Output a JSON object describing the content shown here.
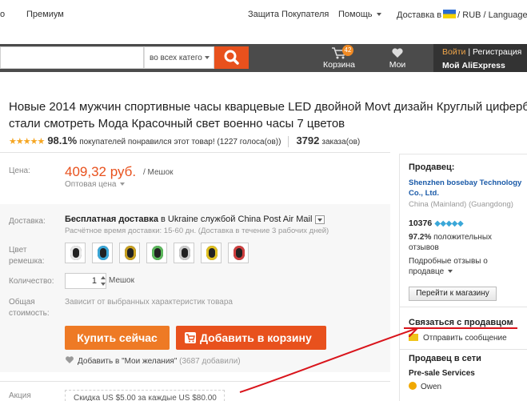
{
  "topbar": {
    "left_partial": "о",
    "premium": "Премиум",
    "buyer_protection": "Защита Покупателя",
    "help": "Помощь",
    "ship_to": "Доставка в",
    "currency_lang": "/ RUB / Language"
  },
  "search": {
    "category": "во всех катего",
    "icon": "search-icon"
  },
  "nav": {
    "cart_label": "Корзина",
    "cart_count": "42",
    "wishlist_label": "Мои желания",
    "login": "Войти",
    "register": "| Регистрация",
    "my_account": "Мой AliExpress"
  },
  "product": {
    "title_line1": "Новые 2014 мужчин спортивные часы кварцевые LED двойной Movt дизайн Круглый циферблат",
    "title_line2": "стали смотреть Мода Красочный свет военно часы 7 цветов",
    "stars": "★★★★★",
    "rating_pct": "98.1%",
    "rating_text": "покупателей понравился этот товар! (1227 голоса(ов))",
    "orders_count": "3792",
    "orders_label": "заказа(ов)",
    "price_label": "Цена:",
    "price": "409,32 руб.",
    "per_unit": "/ Мешок",
    "wholesale": "Оптовая цена",
    "shipping_label": "Доставка:",
    "shipping_free": "Бесплатная доставка",
    "shipping_rest": "в  Ukraine службой China Post Air Mail",
    "shipping_time": "Расчётное время доставки: 15-60 дн. (Доставка в течение 3 рабочих дней)",
    "color_label_1": "Цвет",
    "color_label_2": "ремешка:",
    "quantity_label": "Количество:",
    "quantity_value": "1",
    "quantity_unit": "Мешок",
    "total_label_1": "Общая",
    "total_label_2": "стоимость:",
    "total_note": "Зависит от выбранных характеристик товара",
    "buy_now": "Купить сейчас",
    "add_to_cart": "Добавить в корзину",
    "wish_text": "Добавить в \"Мои желания\"",
    "wish_count": "(3687 добавили)",
    "promo_label": "Акция",
    "promo_text": "Скидка US $5.00 за каждые US $80.00"
  },
  "swatch_dial_colors": [
    "#e8e8e8",
    "#3aa7d8",
    "#c8a020",
    "#5cb85c",
    "#cccccc",
    "#e0c020",
    "#d04040"
  ],
  "seller": {
    "heading": "Продавец:",
    "store_name": "Shenzhen bosebay Technology Co., Ltd.",
    "location": "China (Mainland) (Guangdong)",
    "score": "10376",
    "diamonds": "◆◆◆◆◆",
    "positive_pct": "97.2%",
    "positive_text": "положительных отзывов",
    "good_reviews": "Подробные отзывы о продавце",
    "go_to_store": "Перейти к магазину",
    "contact_title": "Связаться с продавцом",
    "send_message": "Отправить сообщение",
    "online_title": "Продавец в сети",
    "presale": "Pre-sale Services",
    "agent": "Owen"
  },
  "colors": {
    "accent_orange": "#e8511d",
    "buy_orange": "#ee7a25",
    "band": "#4b4b4b",
    "link_blue": "#1a5aa8",
    "annotation_red": "#d9141b"
  }
}
